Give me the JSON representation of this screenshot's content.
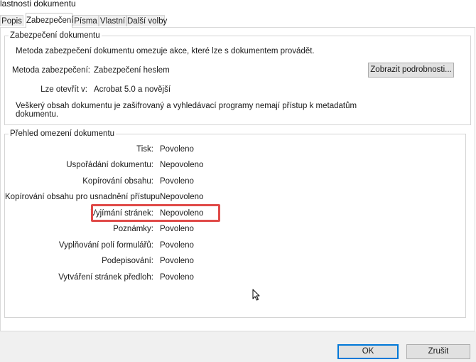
{
  "window": {
    "title": "lastnosti dokumentu"
  },
  "tabs": [
    {
      "label": "Popis",
      "active": false
    },
    {
      "label": "Zabezpečení",
      "active": true
    },
    {
      "label": "Písma",
      "active": false
    },
    {
      "label": "Vlastní",
      "active": false
    },
    {
      "label": "Další volby",
      "active": false
    }
  ],
  "security": {
    "title": "Zabezpečení dokumentu",
    "intro": "Metoda zabezpečení dokumentu omezuje akce, které lze s dokumentem provádět.",
    "method_label": "Metoda zabezpečení:",
    "method_value": "Zabezpečení heslem",
    "details_button": "Zobrazit podrobnosti...",
    "opens_label": "Lze otevřít v:",
    "opens_value": "Acrobat 5.0 a novější",
    "note_line1": "Veškerý obsah dokumentu je zašifrovaný a vyhledávací programy nemají přístup k metadatům",
    "note_line2": "dokumentu."
  },
  "restrictions": {
    "title": "Přehled omezení dokumentu",
    "rows": [
      {
        "label": "Tisk:",
        "value": "Povoleno"
      },
      {
        "label": "Uspořádání dokumentu:",
        "value": "Nepovoleno"
      },
      {
        "label": "Kopírování obsahu:",
        "value": "Povoleno"
      },
      {
        "label": "Kopírování obsahu pro usnadnění přístupu:",
        "value": "Nepovoleno"
      },
      {
        "label": "Vyjímání stránek:",
        "value": "Nepovoleno"
      },
      {
        "label": "Poznámky:",
        "value": "Povoleno"
      },
      {
        "label": "Vyplňování polí formulářů:",
        "value": "Povoleno"
      },
      {
        "label": "Podepisování:",
        "value": "Povoleno"
      },
      {
        "label": "Vytváření stránek předloh:",
        "value": "Povoleno"
      }
    ]
  },
  "footer": {
    "ok_label": "OK",
    "cancel_label": "Zrušit"
  },
  "colors": {
    "highlight": "#e04a48",
    "accent": "#0078d7"
  }
}
